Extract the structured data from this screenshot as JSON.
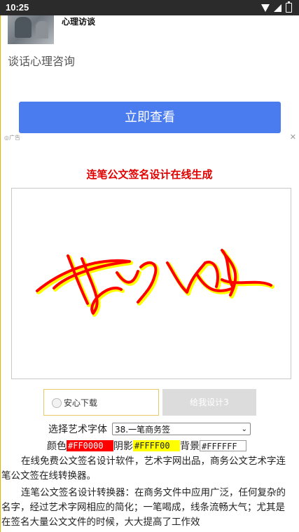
{
  "status_bar": {
    "time": "10:25"
  },
  "ad": {
    "title": "心理访谈",
    "subtitle": "谈话心理咨询",
    "cta_label": "立即查看",
    "ad_marker": "广告",
    "close": "✕"
  },
  "page": {
    "heading": "连笔公文签名设计在线生成"
  },
  "actions": {
    "download_label": "安心下载",
    "design_label": "给我设计3"
  },
  "form": {
    "font_label": "选择艺术字体",
    "font_value": "38.一笔商务签",
    "color_label": "颜色",
    "color_value": "#FF0000",
    "shadow_label": "阴影",
    "shadow_value": "#FFFF00",
    "bg_label": "背景",
    "bg_value": "#FFFFFF"
  },
  "description": {
    "para1": "在线免费公文签名设计软件，艺术字网出品，商务公文艺术字连笔公文签在线转换器。",
    "para2": "连笔公文签名设计转换器：在商务文件中应用广泛，任何复杂的名字，经过艺术字网相应的简化；一笔喝成，线条流畅大气；尤其是在签名大量公文文件的时候，大大提高了工作效"
  },
  "colors": {
    "accent_blue": "#4a7cf0",
    "heading_red": "#e00000",
    "signature_red": "#ff0000",
    "signature_shadow": "#ffff00"
  }
}
